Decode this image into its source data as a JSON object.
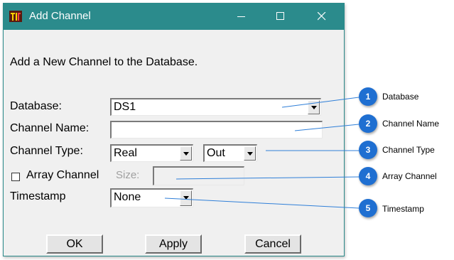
{
  "window": {
    "title": "Add Channel",
    "icon": "app-logo-icon",
    "controls": [
      "minimize-icon",
      "maximize-icon",
      "close-icon"
    ]
  },
  "form": {
    "heading": "Add a New Channel to the Database.",
    "database_label": "Database:",
    "database_value": "DS1",
    "channel_name_label": "Channel Name:",
    "channel_name_value": "",
    "channel_type_label": "Channel Type:",
    "channel_type_value": "Real",
    "direction_value": "Out",
    "array_channel_label": "Array Channel",
    "array_channel_checked": false,
    "size_label": "Size:",
    "size_value": "",
    "timestamp_label": "Timestamp",
    "timestamp_value": "None"
  },
  "buttons": {
    "ok": "OK",
    "apply": "Apply",
    "cancel": "Cancel"
  },
  "callouts": [
    {
      "number": "1",
      "label": "Database"
    },
    {
      "number": "2",
      "label": "Channel Name"
    },
    {
      "number": "3",
      "label": "Channel Type"
    },
    {
      "number": "4",
      "label": "Array Channel"
    },
    {
      "number": "5",
      "label": "Timestamp"
    }
  ],
  "colors": {
    "titlebar": "#2b8b8c",
    "callout_badge": "#1f6fd1",
    "callout_line": "#2f7fd8"
  }
}
